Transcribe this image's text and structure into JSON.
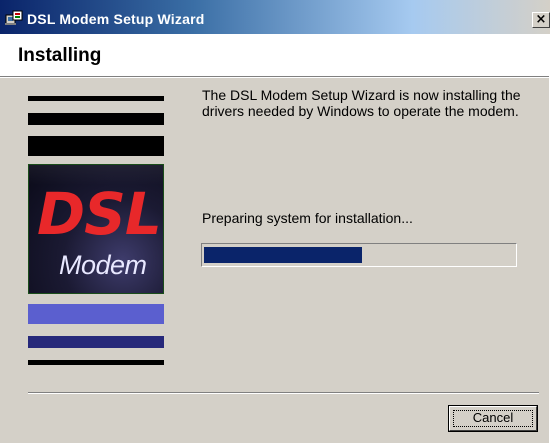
{
  "window": {
    "title": "DSL Modem Setup Wizard",
    "close_glyph": "×",
    "icon": "setup-wizard-icon"
  },
  "header": {
    "title": "Installing"
  },
  "banner": {
    "brand_top": "DSL",
    "brand_bottom": "Modem",
    "brand_top_color": "#e8282a",
    "brand_bottom_color": "#e8e8ff"
  },
  "main": {
    "description": "The DSL Modem Setup Wizard is now installing the drivers needed by Windows to operate the modem.",
    "status": "Preparing system for installation...",
    "progress_fraction": 0.51,
    "progress_color": "#0a246a"
  },
  "footer": {
    "cancel_label": "Cancel"
  }
}
